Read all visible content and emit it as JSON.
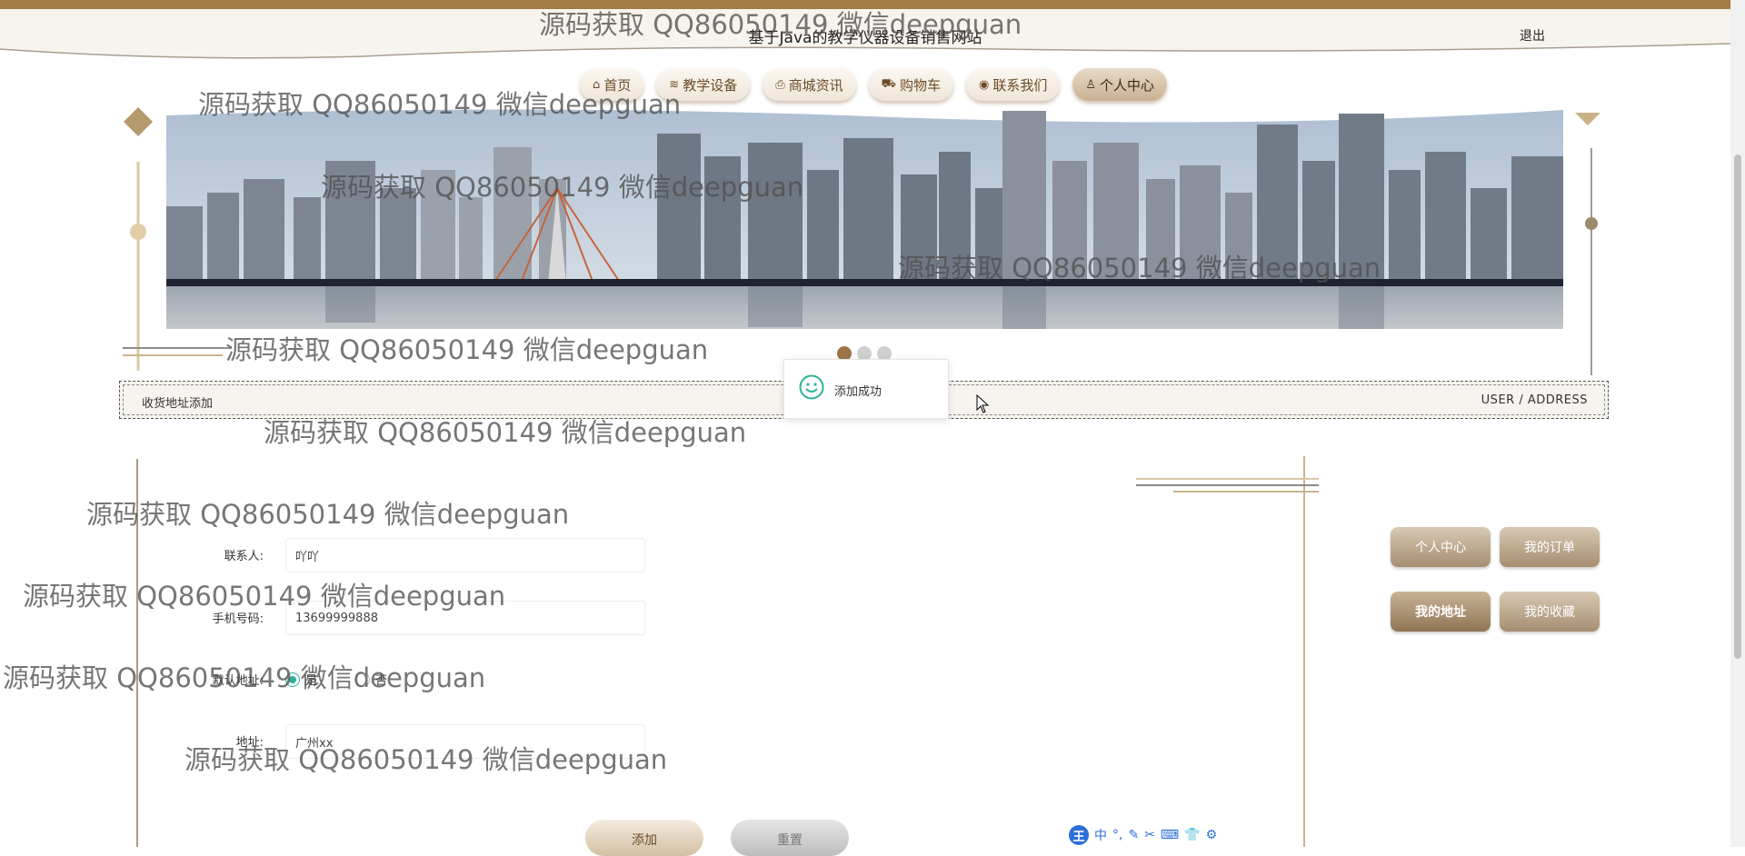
{
  "header": {
    "site_title": "基于Java的教学仪器设备销售网站",
    "logout_label": "退出"
  },
  "nav": {
    "items": [
      {
        "icon": "home-icon",
        "glyph": "⌂",
        "label": "首页"
      },
      {
        "icon": "layers-icon",
        "glyph": "≋",
        "label": "教学设备"
      },
      {
        "icon": "printer-icon",
        "glyph": "⎙",
        "label": "商城资讯"
      },
      {
        "icon": "cart-icon",
        "glyph": "⛟",
        "label": "购物车"
      },
      {
        "icon": "chat-icon",
        "glyph": "◉",
        "label": "联系我们"
      },
      {
        "icon": "user-icon",
        "glyph": "♙",
        "label": "个人中心"
      }
    ],
    "active_index": 5
  },
  "banner": {
    "slide_count": 3,
    "active_slide": 1
  },
  "section": {
    "title": "收货地址添加",
    "subtitle": "USER / ADDRESS"
  },
  "toast": {
    "message": "添加成功"
  },
  "form": {
    "contact_label": "联系人:",
    "contact_value": "吖吖",
    "phone_label": "手机号码:",
    "phone_value": "13699999888",
    "default_label": "默认地址:",
    "default_yes": "是",
    "default_no": "否",
    "default_selected": "是",
    "address_label": "地址:",
    "address_value": "广州xx",
    "add_button": "添加",
    "reset_button": "重置"
  },
  "side_menu": {
    "items": [
      "个人中心",
      "我的订单",
      "我的地址",
      "我的收藏"
    ],
    "active": "我的地址"
  },
  "ime_toolbar": {
    "logo": "王",
    "mode": "中",
    "items": [
      "°,",
      "✎",
      "✂",
      "⌨",
      "👕",
      "⚙"
    ]
  },
  "watermark": {
    "text": "源码获取 QQ86050149 微信deepguan"
  },
  "colors": {
    "accent_brown": "#a47a45",
    "button_gold": "#a68e70",
    "success_green": "#2bb39a"
  }
}
